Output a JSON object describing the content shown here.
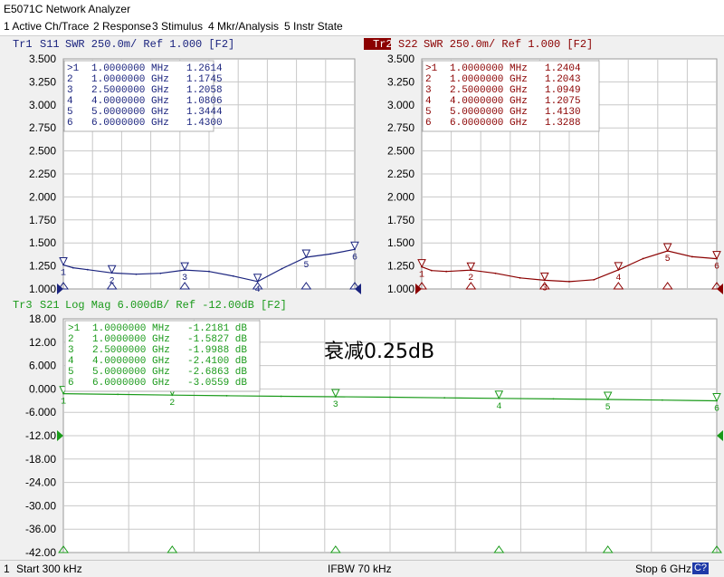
{
  "window": {
    "title": "E5071C Network Analyzer"
  },
  "menu": [
    {
      "label": "1 Active Ch/Trace"
    },
    {
      "label": "2 Response"
    },
    {
      "label": "3 Stimulus"
    },
    {
      "label": "4 Mkr/Analysis"
    },
    {
      "label": "5 Instr State"
    }
  ],
  "colors": {
    "tr1": "#1a237e",
    "tr2": "#8b0000",
    "tr3": "#1a9a1a",
    "grid": "#c8c8c8"
  },
  "annotation": "衰减0.25dB",
  "status": {
    "channel": "1",
    "start": "Start 300 kHz",
    "ifbw": "IFBW 70 kHz",
    "stop": "Stop 6 GHz",
    "cal": "C?"
  },
  "chart_data": [
    {
      "type": "line",
      "trace": "Tr1",
      "param": "S11",
      "format": "SWR 250.0m/ Ref 1.000 [F2]",
      "xlim": [
        0.0003,
        6
      ],
      "ylim": [
        1.0,
        3.5
      ],
      "yticks": [
        "3.500",
        "3.250",
        "3.000",
        "2.750",
        "2.500",
        "2.250",
        "2.000",
        "1.750",
        "1.500",
        "1.250",
        "1.000"
      ],
      "markers": [
        {
          "id": ">1",
          "freq": "1.0000000 MHz",
          "value": "1.2614"
        },
        {
          "id": "2",
          "freq": "1.0000000 GHz",
          "value": "1.1745"
        },
        {
          "id": "3",
          "freq": "2.5000000 GHz",
          "value": "1.2058"
        },
        {
          "id": "4",
          "freq": "4.0000000 GHz",
          "value": "1.0806"
        },
        {
          "id": "5",
          "freq": "5.0000000 GHz",
          "value": "1.3444"
        },
        {
          "id": "6",
          "freq": "6.0000000 GHz",
          "value": "1.4300"
        }
      ],
      "x": [
        0.001,
        0.2,
        0.5,
        1.0,
        1.5,
        2.0,
        2.5,
        3.0,
        3.5,
        4.0,
        4.5,
        5.0,
        5.5,
        6.0
      ],
      "y": [
        1.2614,
        1.23,
        1.21,
        1.1745,
        1.16,
        1.17,
        1.2058,
        1.19,
        1.14,
        1.0806,
        1.22,
        1.3444,
        1.38,
        1.43
      ]
    },
    {
      "type": "line",
      "trace": "Tr2",
      "param": "S22",
      "format": "SWR 250.0m/ Ref 1.000 [F2]",
      "xlim": [
        0.0003,
        6
      ],
      "ylim": [
        1.0,
        3.5
      ],
      "yticks": [
        "3.500",
        "3.250",
        "3.000",
        "2.750",
        "2.500",
        "2.250",
        "2.000",
        "1.750",
        "1.500",
        "1.250",
        "1.000"
      ],
      "markers": [
        {
          "id": ">1",
          "freq": "1.0000000 MHz",
          "value": "1.2404"
        },
        {
          "id": "2",
          "freq": "1.0000000 GHz",
          "value": "1.2043"
        },
        {
          "id": "3",
          "freq": "2.5000000 GHz",
          "value": "1.0949"
        },
        {
          "id": "4",
          "freq": "4.0000000 GHz",
          "value": "1.2075"
        },
        {
          "id": "5",
          "freq": "5.0000000 GHz",
          "value": "1.4130"
        },
        {
          "id": "6",
          "freq": "6.0000000 GHz",
          "value": "1.3288"
        }
      ],
      "x": [
        0.001,
        0.2,
        0.5,
        1.0,
        1.5,
        2.0,
        2.5,
        3.0,
        3.5,
        4.0,
        4.5,
        5.0,
        5.5,
        6.0
      ],
      "y": [
        1.2404,
        1.2,
        1.19,
        1.2043,
        1.17,
        1.12,
        1.0949,
        1.08,
        1.1,
        1.2075,
        1.33,
        1.413,
        1.35,
        1.3288
      ]
    },
    {
      "type": "line",
      "trace": "Tr3",
      "param": "S21",
      "format": "Log Mag 6.000dB/ Ref -12.00dB [F2]",
      "xlim": [
        0.0003,
        6
      ],
      "ylim": [
        -42.0,
        18.0
      ],
      "yticks": [
        "18.00",
        "12.00",
        "6.000",
        "0.000",
        "-6.000",
        "-12.00",
        "-18.00",
        "-24.00",
        "-30.00",
        "-36.00",
        "-42.00"
      ],
      "markers": [
        {
          "id": ">1",
          "freq": "1.0000000 MHz",
          "value": "-1.2181 dB"
        },
        {
          "id": "2",
          "freq": "1.0000000 GHz",
          "value": "-1.5827 dB"
        },
        {
          "id": "3",
          "freq": "2.5000000 GHz",
          "value": "-1.9988 dB"
        },
        {
          "id": "4",
          "freq": "4.0000000 GHz",
          "value": "-2.4100 dB"
        },
        {
          "id": "5",
          "freq": "5.0000000 GHz",
          "value": "-2.6863 dB"
        },
        {
          "id": "6",
          "freq": "6.0000000 GHz",
          "value": "-3.0559 dB"
        }
      ],
      "x": [
        0.001,
        0.5,
        1.0,
        1.5,
        2.0,
        2.5,
        3.0,
        3.5,
        4.0,
        4.5,
        5.0,
        5.5,
        6.0
      ],
      "y": [
        -1.2181,
        -1.4,
        -1.5827,
        -1.75,
        -1.88,
        -1.9988,
        -2.12,
        -2.28,
        -2.41,
        -2.55,
        -2.6863,
        -2.85,
        -3.0559
      ]
    }
  ]
}
